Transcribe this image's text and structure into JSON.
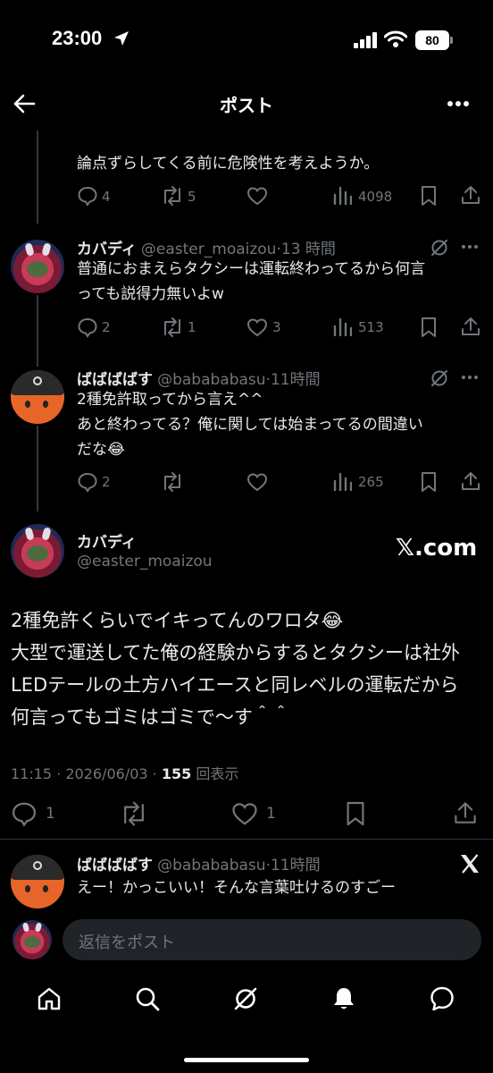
{
  "status_bar": {
    "time": "23:00",
    "battery": "80"
  },
  "header": {
    "title": "ポスト"
  },
  "posts": [
    {
      "text": "論点ずらしてくる前に危険性を考えようか。",
      "replies": "4",
      "reposts": "5",
      "views": "4098"
    },
    {
      "name": "カバディ",
      "handle": "@easter_moaizou",
      "time": "13 時間",
      "text_lines": [
        "普通におまえらタクシーは運転終わってるから何言",
        "っても説得力無いよw"
      ],
      "replies": "2",
      "reposts": "1",
      "likes": "3",
      "views": "513"
    },
    {
      "name": "ばばばばす",
      "handle": "@babababasu",
      "time": "11時間",
      "text_lines": [
        "2種免許取ってから言え^^",
        "あと終わってる？俺に関しては始まってるの間違い",
        "だな😂"
      ],
      "replies": "2",
      "views": "265"
    }
  ],
  "main_post": {
    "name": "カバディ",
    "handle": "@easter_moaizou",
    "source_label": "𝕏.com",
    "text_lines": [
      "2種免許くらいでイキってんのワロタ😂",
      "大型で運送してた俺の経験からするとタクシーは社外",
      "LEDテールの土方ハイエースと同レベルの運転だから",
      "何言ってもゴミはゴミで〜す＾＾"
    ],
    "timestamp": "11:15 · 2026/06/03 · ",
    "views_count": "155",
    "views_label": " 回表示",
    "replies": "1",
    "likes": "1"
  },
  "reply_preview": {
    "name": "ばばばばす",
    "handle": "@babababasu",
    "time": "11時間",
    "text": "えー！かっこいい！そんな言葉吐けるのすごー"
  },
  "reply_bar": {
    "placeholder": "返信をポスト"
  },
  "tab_bar": [
    "home-icon",
    "search-icon",
    "grok-icon",
    "notifications-icon",
    "messages-icon"
  ]
}
